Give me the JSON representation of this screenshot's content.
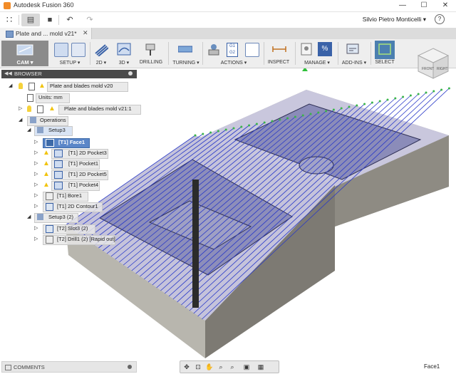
{
  "titlebar": {
    "app_title": "Autodesk Fusion 360",
    "min": "—",
    "max": "☐",
    "close": "✕"
  },
  "qab": {
    "grid": "∷",
    "file": "▤",
    "save": "■",
    "undo": "↶",
    "redo": "↷",
    "user": "Silvio Pietro Monticelli ▾",
    "help": "?"
  },
  "tab": {
    "label": "Plate and ... mold v21*",
    "close": "✕"
  },
  "ribbon": {
    "workspace": "CAM ▾",
    "groups": [
      "SETUP ▾",
      "2D ▾",
      "3D ▾",
      "DRILLING",
      "TURNING ▾",
      "ACTIONS ▾",
      "INSPECT",
      "MANAGE ▾",
      "ADD-INS ▾",
      "SELECT"
    ],
    "actions_g1": "G1",
    "actions_g2": "G2"
  },
  "viewcube": {
    "front": "FRONT",
    "right": "RIGHT"
  },
  "browser": {
    "title": "BROWSER",
    "items": [
      {
        "label": "Plate and blades mold v20"
      },
      {
        "label": "Units: mm"
      },
      {
        "label": "Plate and blades mold v21:1"
      },
      {
        "label": "Operations"
      },
      {
        "label": "Setup3"
      },
      {
        "label": "[T1] Face1"
      },
      {
        "label": "[T1] 2D Pocket3"
      },
      {
        "label": "[T1] Pocket1"
      },
      {
        "label": "[T1] 2D Pocket5"
      },
      {
        "label": "[T1] Pocket4"
      },
      {
        "label": "[T1] Bore1"
      },
      {
        "label": "[T1] 2D Contour1"
      },
      {
        "label": "Setup3 (2)"
      },
      {
        "label": "[T2] Slot3 (2)"
      },
      {
        "label": "[T2] Drill1 (2) [Rapid out]"
      }
    ]
  },
  "comments": {
    "label": "COMMENTS"
  },
  "status": {
    "selection": "Face1"
  }
}
